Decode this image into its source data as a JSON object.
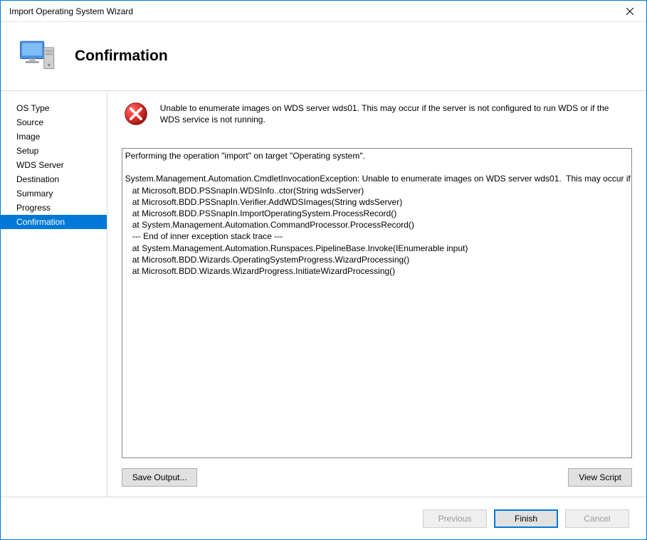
{
  "window": {
    "title": "Import Operating System Wizard"
  },
  "heading": "Confirmation",
  "sidebar": {
    "steps": [
      "OS Type",
      "Source",
      "Image",
      "Setup",
      "WDS Server",
      "Destination",
      "Summary",
      "Progress",
      "Confirmation"
    ],
    "selected": "Confirmation"
  },
  "error_message": "Unable to enumerate images on WDS server wds01.  This may occur if the server is not configured to run WDS or if the WDS service is not running.",
  "log_text": "Performing the operation \"import\" on target \"Operating system\".\n\nSystem.Management.Automation.CmdletInvocationException: Unable to enumerate images on WDS server wds01.  This may occur if the server is not configured to run WDS or if the WDS service is not running.\n   at Microsoft.BDD.PSSnapIn.WDSInfo..ctor(String wdsServer)\n   at Microsoft.BDD.PSSnapIn.Verifier.AddWDSImages(String wdsServer)\n   at Microsoft.BDD.PSSnapIn.ImportOperatingSystem.ProcessRecord()\n   at System.Management.Automation.CommandProcessor.ProcessRecord()\n   --- End of inner exception stack trace ---\n   at System.Management.Automation.Runspaces.PipelineBase.Invoke(IEnumerable input)\n   at Microsoft.BDD.Wizards.OperatingSystemProgress.WizardProcessing()\n   at Microsoft.BDD.Wizards.WizardProgress.InitiateWizardProcessing()\n",
  "buttons": {
    "save_output": "Save Output...",
    "view_script": "View Script",
    "previous": "Previous",
    "finish": "Finish",
    "cancel": "Cancel"
  }
}
